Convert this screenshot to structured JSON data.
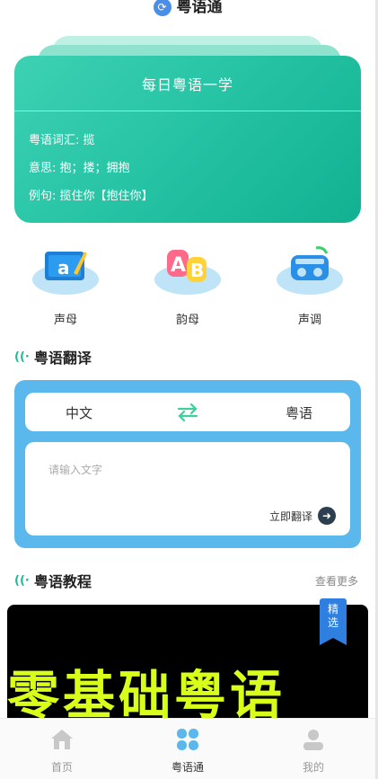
{
  "header": {
    "app_title": "粤语通"
  },
  "daily": {
    "title": "每日粤语一学",
    "vocab": "粤语词汇: 揽",
    "meaning": "意思: 抱；搂；拥抱",
    "example": "例句: 揽住你【抱住你】"
  },
  "categories": [
    {
      "label": "声母",
      "icon": "keyboard-a-icon"
    },
    {
      "label": "韵母",
      "icon": "ab-letters-icon"
    },
    {
      "label": "声调",
      "icon": "radio-icon"
    }
  ],
  "translate": {
    "section_title": "粤语翻译",
    "from_lang": "中文",
    "to_lang": "粤语",
    "placeholder": "请输入文字",
    "submit_label": "立即翻译"
  },
  "tutorial": {
    "section_title": "粤语教程",
    "more_label": "查看更多",
    "banner_text": "零基础粤语",
    "badge_line1": "精",
    "badge_line2": "选"
  },
  "tabbar": {
    "items": [
      {
        "label": "首页",
        "icon": "home-icon",
        "active": false
      },
      {
        "label": "粤语通",
        "icon": "clover-icon",
        "active": true
      },
      {
        "label": "我的",
        "icon": "user-icon",
        "active": false
      }
    ]
  },
  "colors": {
    "accent_green": "#25c3a4",
    "translate_blue": "#5bb8ec",
    "banner_yellow": "#d8ff1a",
    "badge_blue": "#2f7fe0"
  }
}
